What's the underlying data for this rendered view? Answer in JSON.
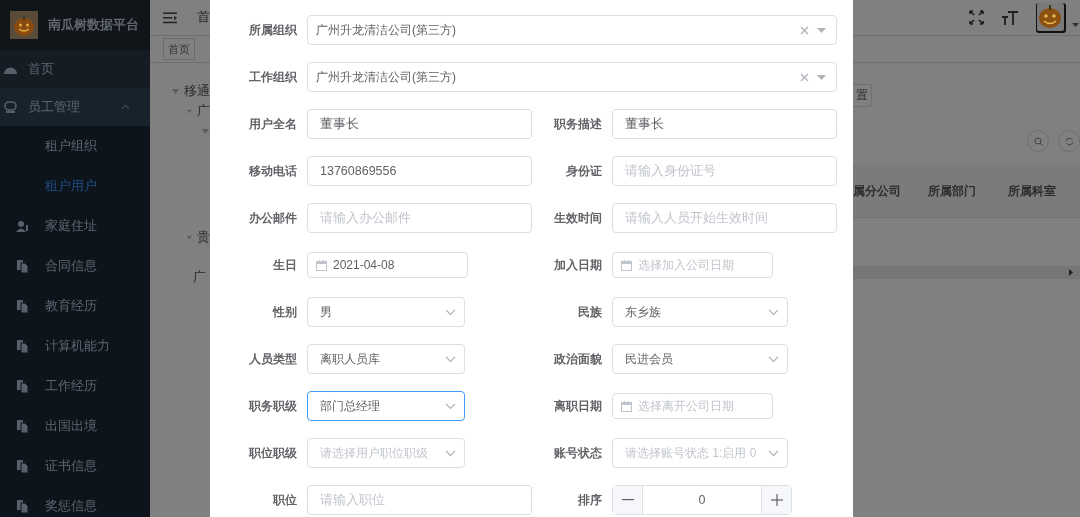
{
  "sidebar": {
    "title": "南瓜树数据平台",
    "items": [
      {
        "label": "首页",
        "selected": false
      },
      {
        "label": "员工管理",
        "selected": false,
        "expanded": true,
        "children": [
          {
            "label": "租户组织",
            "selected": false
          },
          {
            "label": "租户用户",
            "selected": true
          },
          {
            "label": "家庭住址",
            "selected": false
          },
          {
            "label": "合同信息",
            "selected": false
          },
          {
            "label": "教育经历",
            "selected": false
          },
          {
            "label": "计算机能力",
            "selected": false
          },
          {
            "label": "工作经历",
            "selected": false
          },
          {
            "label": "出国出境",
            "selected": false
          },
          {
            "label": "证书信息",
            "selected": false
          },
          {
            "label": "奖惩信息",
            "selected": false
          }
        ]
      }
    ]
  },
  "header": {
    "breadcrumb": "首"
  },
  "tags": [
    {
      "label": "首页"
    }
  ],
  "tree": [
    {
      "label": "移通",
      "expanded": true,
      "children": [
        {
          "label": "广",
          "expanded": true,
          "children": [
            {
              "expanded": true
            }
          ]
        },
        {
          "label": "贵",
          "expanded": true,
          "children": [
            {
              "label": "广"
            }
          ]
        }
      ]
    }
  ],
  "toolbar": {
    "reset_button": "置"
  },
  "table": {
    "columns": [
      "属分公司",
      "所属部门",
      "所属科室"
    ]
  },
  "form": {
    "rows": [
      {
        "fields": [
          {
            "label": "所属组织",
            "kind": "tree-select",
            "value": "广州升龙清洁公司(第三方)",
            "focused": false
          }
        ]
      },
      {
        "fields": [
          {
            "label": "工作组织",
            "kind": "tree-select",
            "value": "广州升龙清洁公司(第三方)",
            "focused": false
          }
        ]
      },
      {
        "fields": [
          {
            "label": "用户全名",
            "kind": "input",
            "value": "董事长",
            "focused": false
          },
          {
            "label": "职务描述",
            "kind": "input",
            "value": "董事长",
            "focused": false
          }
        ]
      },
      {
        "fields": [
          {
            "label": "移动电话",
            "kind": "input",
            "value": "13760869556",
            "focused": false
          },
          {
            "label": "身份证",
            "kind": "input",
            "placeholder": "请输入身份证号",
            "focused": false
          }
        ]
      },
      {
        "fields": [
          {
            "label": "办公邮件",
            "kind": "input",
            "placeholder": "请输入办公邮件",
            "focused": false
          },
          {
            "label": "生效时间",
            "kind": "input",
            "placeholder": "请输入人员开始生效时间",
            "focused": false
          }
        ]
      },
      {
        "fields": [
          {
            "label": "生日",
            "kind": "date",
            "value": "2021-04-08",
            "focused": false
          },
          {
            "label": "加入日期",
            "kind": "date",
            "placeholder": "选择加入公司日期",
            "focused": false
          }
        ]
      },
      {
        "fields": [
          {
            "label": "性别",
            "kind": "select",
            "value": "男",
            "focused": false
          },
          {
            "label": "民族",
            "kind": "select",
            "value": "东乡族",
            "focused": false
          }
        ]
      },
      {
        "fields": [
          {
            "label": "人员类型",
            "kind": "select",
            "value": "离职人员库",
            "focused": false
          },
          {
            "label": "政治面貌",
            "kind": "select",
            "value": "民进会员",
            "focused": false
          }
        ]
      },
      {
        "fields": [
          {
            "label": "职务职级",
            "kind": "select",
            "value": "部门总经理",
            "focused": true
          },
          {
            "label": "离职日期",
            "kind": "date",
            "placeholder": "选择离开公司日期",
            "focused": false
          }
        ]
      },
      {
        "fields": [
          {
            "label": "职位职级",
            "kind": "select",
            "placeholder": "请选择用户职位职级",
            "focused": false
          },
          {
            "label": "账号状态",
            "kind": "select",
            "placeholder": "请选择账号状态 1:启用 0",
            "focused": false
          }
        ]
      },
      {
        "fields": [
          {
            "label": "职位",
            "kind": "input",
            "placeholder": "请输入职位",
            "focused": false
          },
          {
            "label": "排序",
            "kind": "number",
            "value": "0",
            "focused": false
          }
        ]
      }
    ]
  }
}
